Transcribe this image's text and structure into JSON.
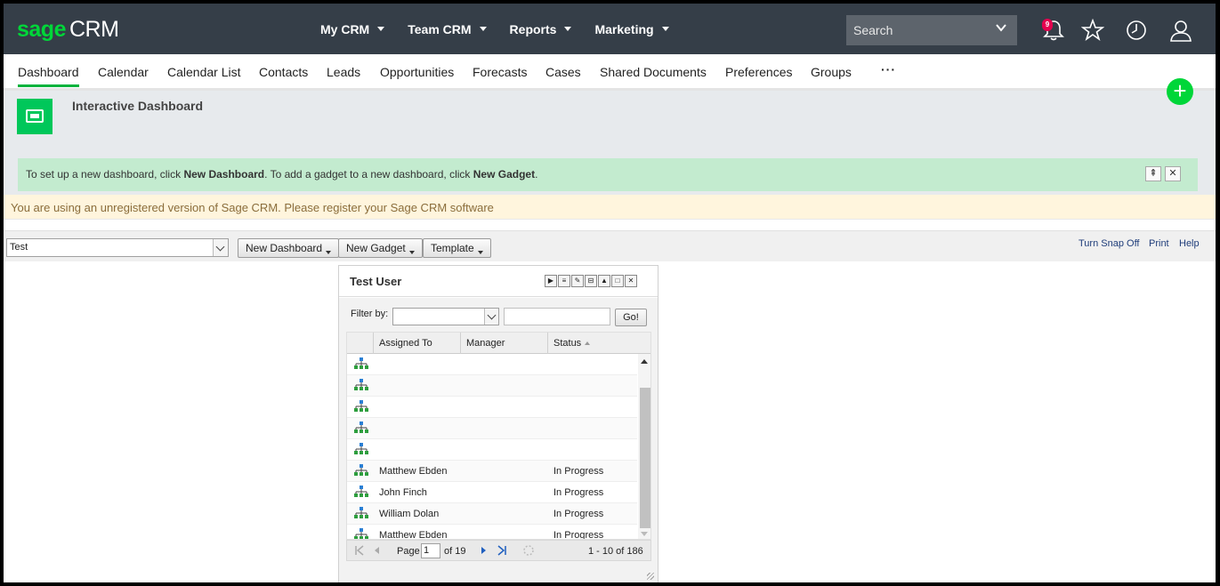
{
  "logo": {
    "brand": "sage",
    "product": "CRM"
  },
  "top_menu": [
    {
      "label": "My CRM"
    },
    {
      "label": "Team CRM"
    },
    {
      "label": "Reports"
    },
    {
      "label": "Marketing"
    }
  ],
  "search": {
    "placeholder": "Search"
  },
  "notifications": {
    "count": "9"
  },
  "tabs": [
    {
      "label": "Dashboard",
      "active": true
    },
    {
      "label": "Calendar"
    },
    {
      "label": "Calendar List"
    },
    {
      "label": "Contacts"
    },
    {
      "label": "Leads"
    },
    {
      "label": "Opportunities"
    },
    {
      "label": "Forecasts"
    },
    {
      "label": "Cases"
    },
    {
      "label": "Shared Documents"
    },
    {
      "label": "Preferences"
    },
    {
      "label": "Groups"
    }
  ],
  "more_label": "···",
  "page": {
    "title": "Interactive Dashboard"
  },
  "info": {
    "part1": "To set up a new dashboard, click ",
    "link1": "New Dashboard",
    "part2": ". To add a gadget to a new dashboard, click ",
    "link2": "New Gadget",
    "part3": "."
  },
  "warning": "You are using an unregistered version of Sage CRM. Please register your Sage CRM software",
  "toolbar": {
    "dashboard_selected": "Test",
    "new_dashboard": "New Dashboard",
    "new_gadget": "New Gadget",
    "template": "Template",
    "turn_snap_off": "Turn Snap Off",
    "print": "Print",
    "help": "Help"
  },
  "gadget": {
    "title": "Test User",
    "filter_label": "Filter by:",
    "go": "Go!",
    "columns": [
      "Assigned To",
      "Manager",
      "Status"
    ],
    "rows": [
      {
        "assigned_to": "",
        "manager": "",
        "status": ""
      },
      {
        "assigned_to": "",
        "manager": "",
        "status": ""
      },
      {
        "assigned_to": "",
        "manager": "",
        "status": ""
      },
      {
        "assigned_to": "",
        "manager": "",
        "status": ""
      },
      {
        "assigned_to": "",
        "manager": "",
        "status": ""
      },
      {
        "assigned_to": "Matthew Ebden",
        "manager": "",
        "status": "In Progress"
      },
      {
        "assigned_to": "John Finch",
        "manager": "",
        "status": "In Progress"
      },
      {
        "assigned_to": "William Dolan",
        "manager": "",
        "status": "In Progress"
      },
      {
        "assigned_to": "Matthew Ebden",
        "manager": "",
        "status": "In Progress"
      }
    ],
    "pager": {
      "page_label": "Page",
      "page": "1",
      "of_label": "of 19",
      "range": "1 - 10 of 186"
    }
  },
  "colors": {
    "topbar": "#353e48",
    "accent": "#00d639",
    "tab_underline": "#00b33c",
    "info_bg": "#c3ebcf",
    "warn_bg": "#fff5dd"
  }
}
